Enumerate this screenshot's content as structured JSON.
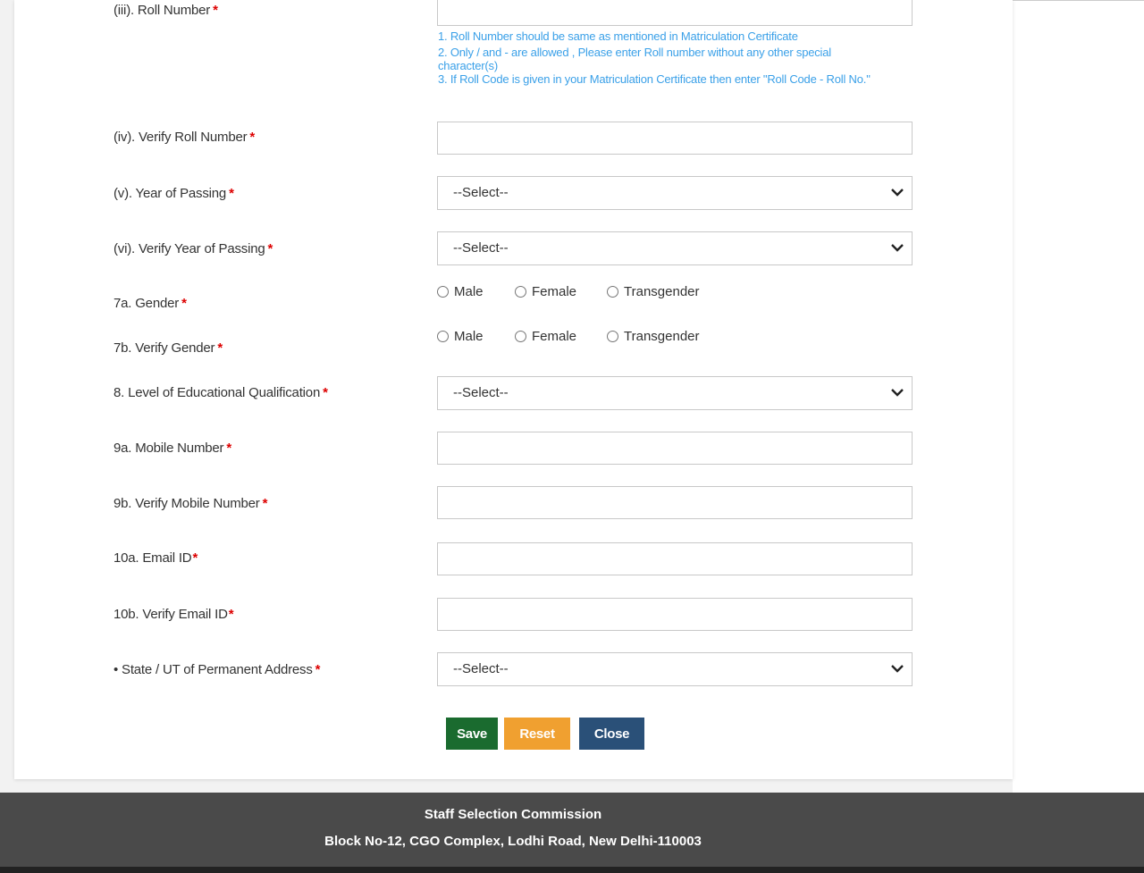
{
  "form": {
    "roll_number": {
      "label": "(iii). Roll Number",
      "value": "",
      "hints": [
        "1. Roll Number should be same as mentioned in Matriculation Certificate",
        "2. Only / and - are allowed , Please enter Roll number without any other special character(s)",
        "3. If Roll Code is given in your Matriculation Certificate then enter \"Roll Code - Roll No.\""
      ]
    },
    "verify_roll_number": {
      "label": "(iv). Verify Roll Number",
      "value": ""
    },
    "year_of_passing": {
      "label": "(v). Year of Passing",
      "selected": "--Select--"
    },
    "verify_year_of_passing": {
      "label": "(vi). Verify Year of Passing",
      "selected": "--Select--"
    },
    "gender": {
      "label": "7a. Gender",
      "options": [
        "Male",
        "Female",
        "Transgender"
      ]
    },
    "verify_gender": {
      "label": "7b. Verify Gender",
      "options": [
        "Male",
        "Female",
        "Transgender"
      ]
    },
    "education": {
      "label": "8. Level of Educational Qualification",
      "selected": "--Select--"
    },
    "mobile": {
      "label": "9a. Mobile Number",
      "value": ""
    },
    "verify_mobile": {
      "label": "9b. Verify Mobile Number",
      "value": ""
    },
    "email": {
      "label": "10a. Email ID",
      "value": ""
    },
    "verify_email": {
      "label": "10b. Verify Email ID",
      "value": ""
    },
    "state": {
      "label": "• State / UT of Permanent Address",
      "selected": "--Select--"
    },
    "required_marker": "*"
  },
  "buttons": {
    "save": {
      "label": "Save",
      "color": "#1a6b2f"
    },
    "reset": {
      "label": "Reset",
      "color": "#f0a030"
    },
    "close": {
      "label": "Close",
      "color": "#2a5078"
    }
  },
  "footer": {
    "org": "Staff Selection Commission",
    "address": "Block No-12, CGO Complex, Lodhi Road, New Delhi-110003"
  }
}
